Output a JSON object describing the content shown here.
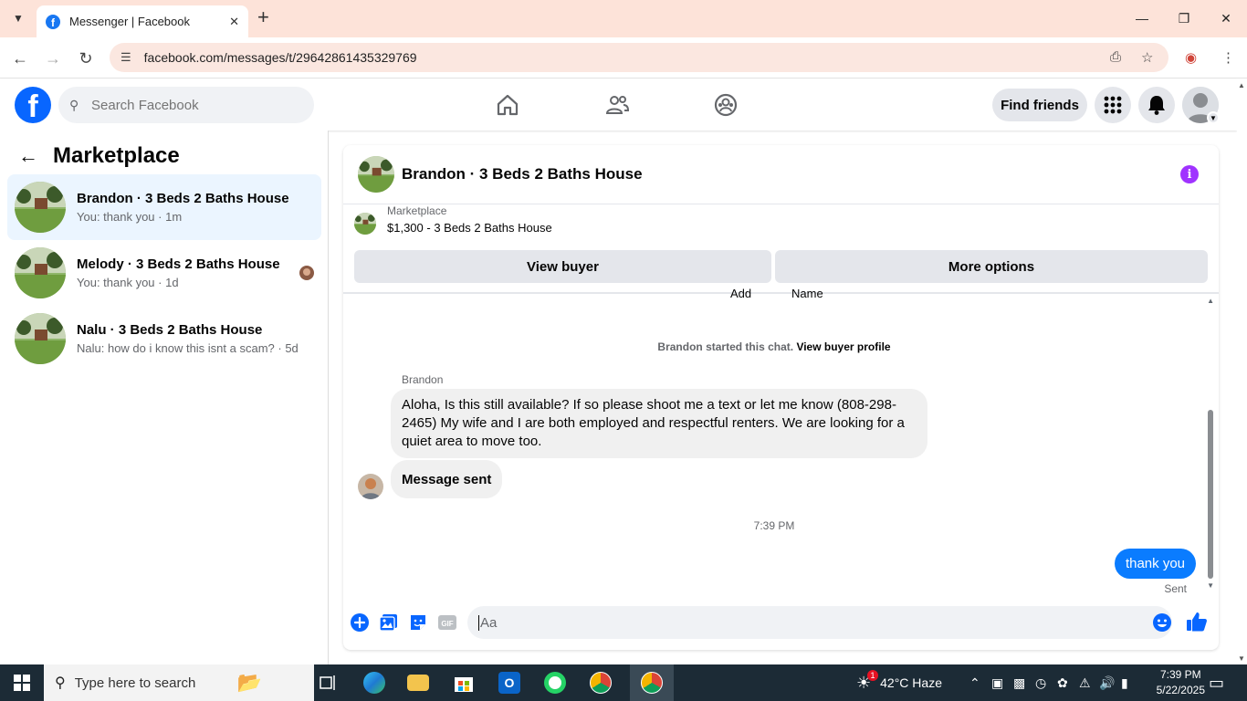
{
  "browser": {
    "tab_title": "Messenger | Facebook",
    "url": "facebook.com/messages/t/29642861435329769"
  },
  "header": {
    "search_placeholder": "Search Facebook",
    "find_friends": "Find friends"
  },
  "sidebar": {
    "title": "Marketplace",
    "conversations": [
      {
        "name": "Brandon · 3 Beds 2 Baths House",
        "preview": "You: thank you · 1m",
        "active": true
      },
      {
        "name": "Melody · 3 Beds 2 Baths House",
        "preview": "You: thank you · 1d",
        "active": false
      },
      {
        "name": "Nalu · 3 Beds 2 Baths House",
        "preview": "Nalu: how do i know this isnt a scam? · 5d",
        "active": false
      }
    ]
  },
  "chat": {
    "title": "Brandon · 3 Beds 2 Baths House",
    "listing_label": "Marketplace",
    "listing_title": "$1,300 - 3 Beds 2 Baths House",
    "view_buyer": "View buyer",
    "more_options": "More options",
    "cut_left": "Add",
    "cut_right": "Name",
    "system_text": "Brandon started this chat.",
    "system_link": "View buyer profile",
    "sender": "Brandon",
    "incoming_message": "Aloha, Is this still available? If so please shoot me a text or let me know (808-298-2465) My wife and I are both employed and respectful renters. We are looking for a quiet area to move too.",
    "message_sent": "Message sent",
    "timestamp": "7:39 PM",
    "outgoing_message": "thank you",
    "status": "Sent",
    "composer_placeholder": "Aa"
  },
  "taskbar": {
    "search_placeholder": "Type here to search",
    "weather": "42°C  Haze",
    "weather_badge": "1",
    "time": "7:39 PM",
    "date": "5/22/2025"
  },
  "colors": {
    "fb_blue": "#0866ff",
    "messenger_blue": "#0a7cff",
    "active_conv": "#ebf5ff",
    "tab_strip": "#fde3d9",
    "info_purple": "#a033ff"
  }
}
